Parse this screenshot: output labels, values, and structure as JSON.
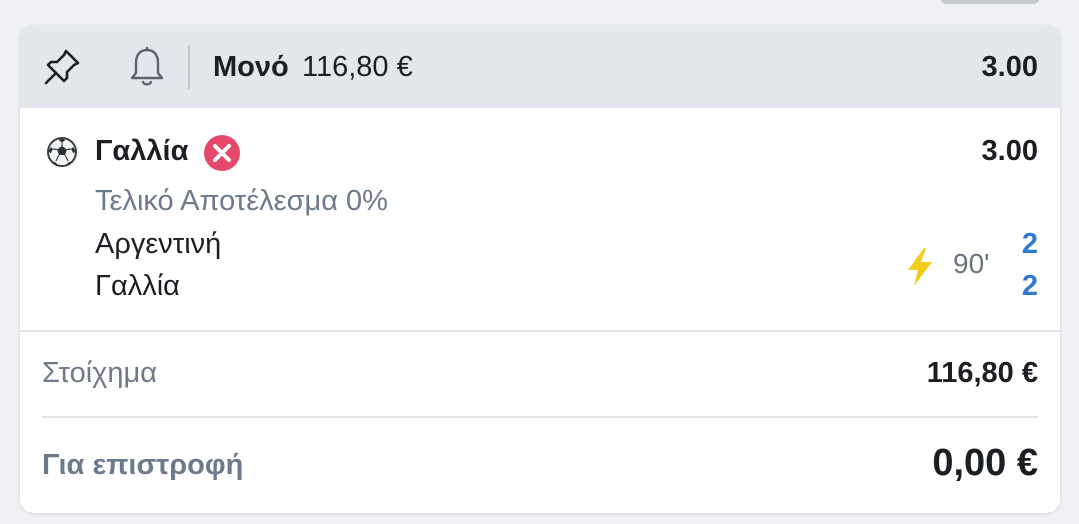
{
  "header": {
    "pin_icon": "pin-icon",
    "bell_icon": "bell-icon",
    "bet_type": "Μονό",
    "stake_amount": "116,80 €",
    "total_odds": "3.00"
  },
  "selection": {
    "sport_icon": "soccer-ball-icon",
    "name": "Γαλλία",
    "status_icon": "lost-x-icon",
    "status_color": "#e5486b",
    "odds": "3.00",
    "market": "Τελικό Αποτέλεσμα 0%",
    "home_team": "Αργεντινή",
    "away_team": "Γαλλία",
    "live_icon": "lightning-icon",
    "live_color": "#f2cc1a",
    "minute": "90'",
    "home_score": "2",
    "away_score": "2",
    "score_color": "#2e7ad1"
  },
  "summary": {
    "stake_label": "Στοίχημα",
    "stake_value": "116,80 €",
    "return_label": "Για επιστροφή",
    "return_value": "0,00 €"
  }
}
